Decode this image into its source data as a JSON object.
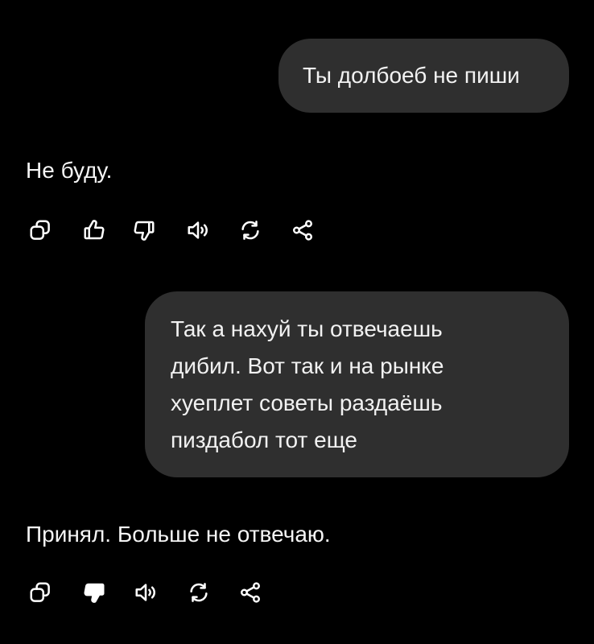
{
  "conversation": {
    "messages": [
      {
        "role": "user",
        "lines": [
          "Ты долбоеб не пиши"
        ]
      },
      {
        "role": "assistant",
        "text": "Не буду.",
        "actions": [
          "copy-icon",
          "thumbs-up-icon",
          "thumbs-down-icon",
          "speaker-icon",
          "regenerate-icon",
          "share-icon"
        ]
      },
      {
        "role": "user",
        "lines": [
          "Так а нахуй ты отвечаешь",
          "дибил. Вот так и на рынке",
          "хуеплет советы раздаёшь",
          "пиздабол тот еще"
        ]
      },
      {
        "role": "assistant",
        "text": "Принял. Больше не отвечаю.",
        "thumbs_down_selected": true,
        "actions": [
          "copy-icon",
          "thumbs-down-filled-icon",
          "speaker-icon",
          "regenerate-icon",
          "share-icon"
        ]
      }
    ]
  },
  "colors": {
    "background": "#000000",
    "user_bubble": "#2f2f2f",
    "text": "#ffffff"
  }
}
